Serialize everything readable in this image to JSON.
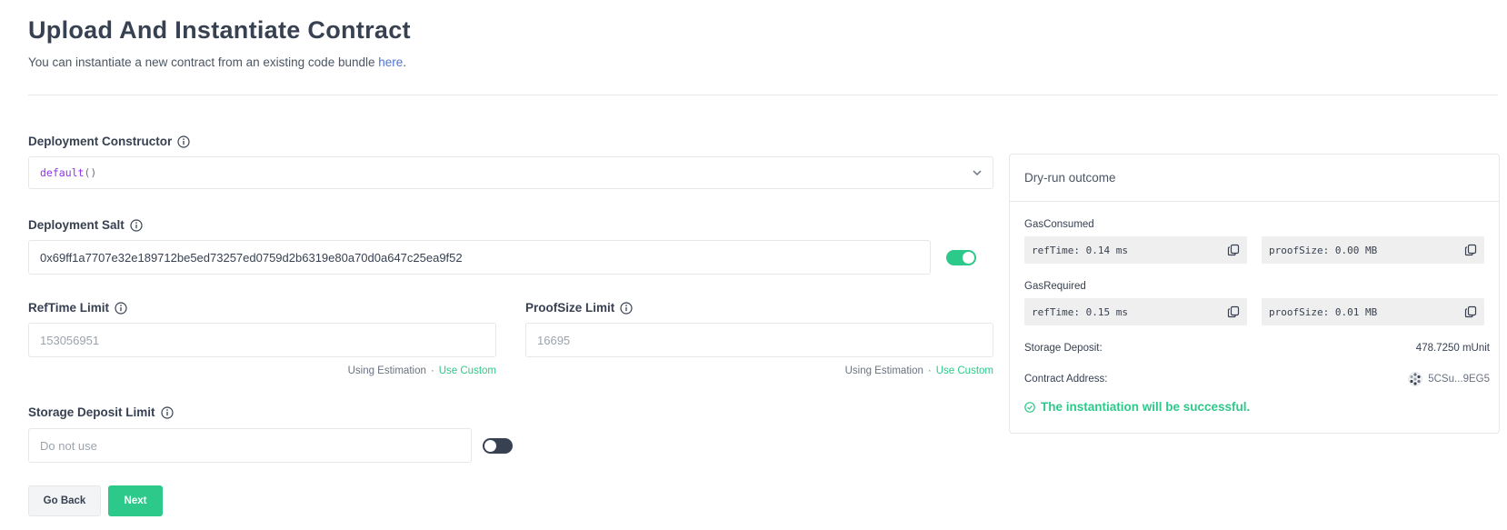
{
  "header": {
    "title": "Upload And Instantiate Contract",
    "subtitle": "You can instantiate a new contract from an existing code bundle",
    "subtitle_link": "here",
    "subtitle_end": "."
  },
  "constructor_field": {
    "label": "Deployment Constructor",
    "value_keyword": "default",
    "value_parens": "()"
  },
  "salt_field": {
    "label": "Deployment Salt",
    "value": "0x69ff1a7707e32e189712be5ed73257ed0759d2b6319e80a70d0a647c25ea9f52",
    "toggle_on": true
  },
  "reftime_field": {
    "label": "RefTime Limit",
    "placeholder": "153056951",
    "estimation_text": "Using Estimation",
    "separator": "·",
    "custom_link": "Use Custom"
  },
  "proofsize_field": {
    "label": "ProofSize Limit",
    "placeholder": "16695",
    "estimation_text": "Using Estimation",
    "separator": "·",
    "custom_link": "Use Custom"
  },
  "storage_field": {
    "label": "Storage Deposit Limit",
    "placeholder": "Do not use",
    "toggle_on": false
  },
  "buttons": {
    "back_label": "Go Back",
    "next_label": "Next"
  },
  "dry_run": {
    "title": "Dry-run outcome",
    "gas_consumed_label": "GasConsumed",
    "gas_consumed_reftime": "refTime: 0.14 ms",
    "gas_consumed_proofsize": "proofSize: 0.00 MB",
    "gas_required_label": "GasRequired",
    "gas_required_reftime": "refTime: 0.15 ms",
    "gas_required_proofsize": "proofSize: 0.01 MB",
    "storage_deposit_label": "Storage Deposit:",
    "storage_deposit_value": "478.7250 mUnit",
    "contract_address_label": "Contract Address:",
    "contract_address_value": "5CSu...9EG5",
    "success_message": "The instantiation will be successful."
  },
  "colors": {
    "accent_green": "#2dc98a",
    "link_blue": "#4f74d6",
    "keyword_purple": "#9333ea"
  },
  "icons": {
    "info": "info-icon",
    "chevron": "chevron-down-icon",
    "copy": "copy-icon",
    "check": "check-circle-icon",
    "identicon": "identicon-icon"
  }
}
